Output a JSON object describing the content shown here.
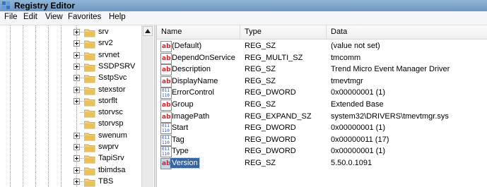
{
  "window": {
    "title": "Registry Editor"
  },
  "menu": [
    "File",
    "Edit",
    "View",
    "Favorites",
    "Help"
  ],
  "tree": {
    "items": [
      {
        "label": "srv",
        "expandable": true
      },
      {
        "label": "srv2",
        "expandable": true
      },
      {
        "label": "srvnet",
        "expandable": true
      },
      {
        "label": "SSDPSRV",
        "expandable": true
      },
      {
        "label": "SstpSvc",
        "expandable": true
      },
      {
        "label": "stexstor",
        "expandable": true
      },
      {
        "label": "storflt",
        "expandable": true
      },
      {
        "label": "storvsc",
        "expandable": false
      },
      {
        "label": "storvsp",
        "expandable": false
      },
      {
        "label": "swenum",
        "expandable": true
      },
      {
        "label": "swprv",
        "expandable": true
      },
      {
        "label": "TapiSrv",
        "expandable": true
      },
      {
        "label": "tbimdsa",
        "expandable": true
      },
      {
        "label": "TBS",
        "expandable": true
      }
    ]
  },
  "columns": {
    "name": "Name",
    "type": "Type",
    "data": "Data"
  },
  "values": [
    {
      "name": "(Default)",
      "type": "REG_SZ",
      "data": "(value not set)",
      "icon": "string-value-icon"
    },
    {
      "name": "DependOnService",
      "type": "REG_MULTI_SZ",
      "data": "tmcomm",
      "icon": "string-value-icon"
    },
    {
      "name": "Description",
      "type": "REG_SZ",
      "data": "Trend Micro Event Manager Driver",
      "icon": "string-value-icon"
    },
    {
      "name": "DisplayName",
      "type": "REG_SZ",
      "data": "tmevtmgr",
      "icon": "string-value-icon"
    },
    {
      "name": "ErrorControl",
      "type": "REG_DWORD",
      "data": "0x00000001 (1)",
      "icon": "binary-value-icon"
    },
    {
      "name": "Group",
      "type": "REG_SZ",
      "data": "Extended Base",
      "icon": "string-value-icon"
    },
    {
      "name": "ImagePath",
      "type": "REG_EXPAND_SZ",
      "data": "system32\\DRIVERS\\tmevtmgr.sys",
      "icon": "string-value-icon"
    },
    {
      "name": "Start",
      "type": "REG_DWORD",
      "data": "0x00000001 (1)",
      "icon": "binary-value-icon"
    },
    {
      "name": "Tag",
      "type": "REG_DWORD",
      "data": "0x00000011 (17)",
      "icon": "binary-value-icon"
    },
    {
      "name": "Type",
      "type": "REG_DWORD",
      "data": "0x00000001 (1)",
      "icon": "binary-value-icon"
    },
    {
      "name": "Version",
      "type": "REG_SZ",
      "data": "5.50.0.1091",
      "icon": "string-value-icon",
      "selected": true
    }
  ],
  "colors": {
    "selection": "#3465a4",
    "folder": "#e8c15a",
    "string_icon": "#c8262c",
    "binary_icon": "#2a4f9c"
  }
}
